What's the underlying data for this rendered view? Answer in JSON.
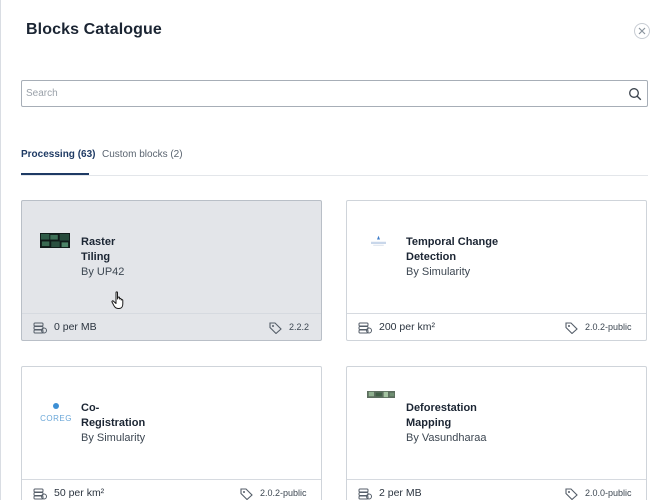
{
  "modal": {
    "title": "Blocks Catalogue",
    "close_icon": "close-icon"
  },
  "search": {
    "placeholder": "Search",
    "value": "",
    "icon": "search-icon"
  },
  "tabs": [
    {
      "label": "Processing (63)",
      "active": true
    },
    {
      "label": "Custom blocks (2)",
      "active": false
    }
  ],
  "cards": [
    {
      "name": "Raster Tiling",
      "by": "By UP42",
      "cost": "0 per MB",
      "version": "2.2.2",
      "logo": "raster-tiling-logo",
      "hovered": true
    },
    {
      "name": "Temporal Change Detection",
      "by": "By Simularity",
      "cost": "200 per km²",
      "version": "2.0.2-public",
      "logo": "simularity-logo",
      "hovered": false
    },
    {
      "name": "Co-Registration",
      "by": "By Simularity",
      "cost": "50 per km²",
      "version": "2.0.2-public",
      "logo": "coreg-logo",
      "logo_text": "COREG",
      "hovered": false
    },
    {
      "name": "Deforestation Mapping",
      "by": "By Vasundharaa",
      "cost": "2 per MB",
      "version": "2.0.0-public",
      "logo": "vasundharaa-logo",
      "hovered": false
    }
  ],
  "colors": {
    "accent": "#1e3a64",
    "card_hover_bg": "#e3e5e9",
    "border": "#cfd4da"
  }
}
